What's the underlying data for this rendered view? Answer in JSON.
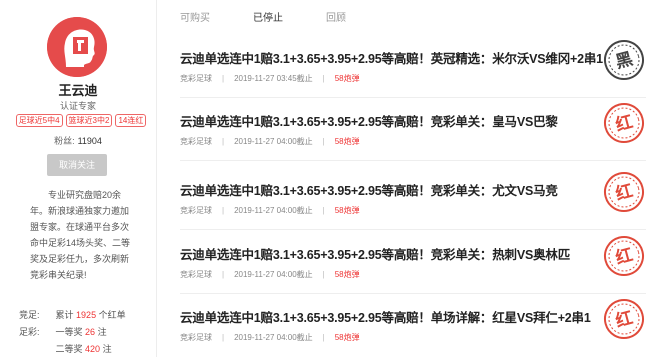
{
  "profile": {
    "name": "王云迪",
    "role": "认证专家",
    "tags": [
      "足球近5中4",
      "篮球近3中2",
      "14连红"
    ],
    "fans_label": "粉丝:",
    "fans_count": "11904",
    "unfollow_label": "取消关注",
    "bio": "专业研究盘赔20余年。新浪球通独家力邀加盟专家。在球通平台多次命中足彩14场头奖、二等奖及足彩任九，多次刷新竞彩串关纪录!",
    "stats": [
      {
        "label": "竞足:",
        "prefix": "累计",
        "value": "1925",
        "suffix": "个红单"
      },
      {
        "label": "足彩:",
        "prefix": "一等奖",
        "value": "26",
        "suffix": "注"
      },
      {
        "label": "",
        "prefix": "二等奖",
        "value": "420",
        "suffix": "注"
      }
    ]
  },
  "tabs": [
    "可购买",
    "已停止",
    "回顾"
  ],
  "active_tab": "已停止",
  "items": [
    {
      "title": "云迪单选连中1赔3.1+3.65+3.95+2.95等高赔！英冠精选：米尔沃VS维冈+2串1",
      "category": "竞彩足球",
      "time": "2019-11-27 03:45截止",
      "price": "58炮弹",
      "stamp": "黑",
      "stamp_color": "#444444"
    },
    {
      "title": "云迪单选连中1赔3.1+3.65+3.95+2.95等高赔！竞彩单关：皇马VS巴黎",
      "category": "竞彩足球",
      "time": "2019-11-27 04:00截止",
      "price": "58炮弹",
      "stamp": "红",
      "stamp_color": "#e04a3a"
    },
    {
      "title": "云迪单选连中1赔3.1+3.65+3.95+2.95等高赔！竞彩单关：尤文VS马竞",
      "category": "竞彩足球",
      "time": "2019-11-27 04:00截止",
      "price": "58炮弹",
      "stamp": "红",
      "stamp_color": "#e04a3a"
    },
    {
      "title": "云迪单选连中1赔3.1+3.65+3.95+2.95等高赔！竞彩单关：热刺VS奥林匹",
      "category": "竞彩足球",
      "time": "2019-11-27 04:00截止",
      "price": "58炮弹",
      "stamp": "红",
      "stamp_color": "#e04a3a"
    },
    {
      "title": "云迪单选连中1赔3.1+3.65+3.95+2.95等高赔！单场详解：红星VS拜仁+2串1",
      "category": "竞彩足球",
      "time": "2019-11-27 04:00截止",
      "price": "58炮弹",
      "stamp": "红",
      "stamp_color": "#e04a3a"
    }
  ],
  "colors": {
    "accent": "#e33333",
    "avatar_bg": "#e54b4b"
  }
}
